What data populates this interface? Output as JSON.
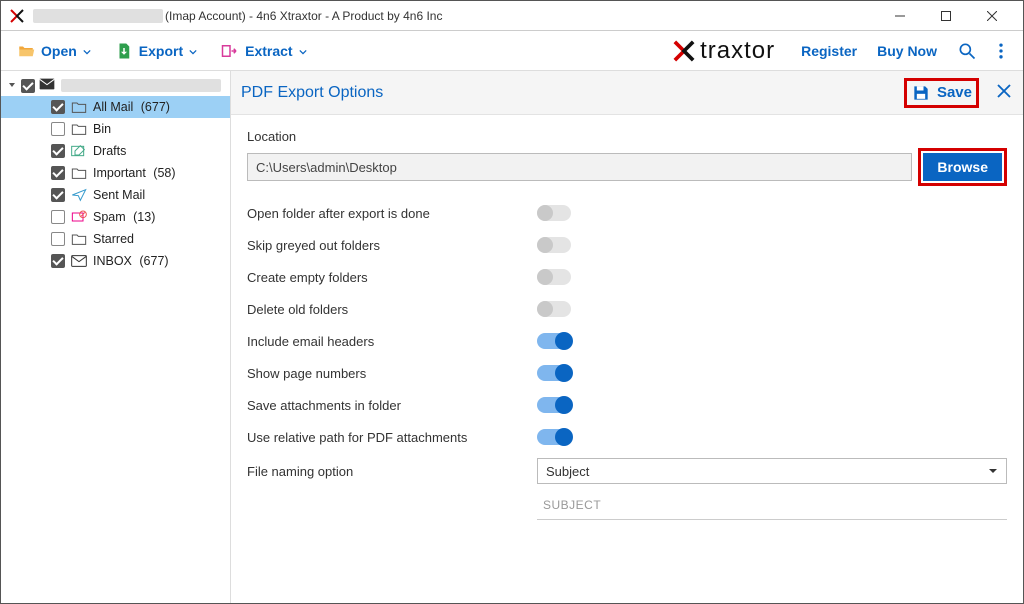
{
  "window": {
    "title_suffix": "(Imap Account) - 4n6 Xtraxtor - A Product by 4n6 Inc"
  },
  "toolbar": {
    "open_label": "Open",
    "export_label": "Export",
    "extract_label": "Extract",
    "register_label": "Register",
    "buynow_label": "Buy Now",
    "brand_text": "traxtor"
  },
  "sidebar": {
    "folders": [
      {
        "label": "All Mail",
        "count": "(677)",
        "checked": true,
        "selected": true,
        "icon": "folder"
      },
      {
        "label": "Bin",
        "count": "",
        "checked": false,
        "selected": false,
        "icon": "folder"
      },
      {
        "label": "Drafts",
        "count": "",
        "checked": true,
        "selected": false,
        "icon": "draft"
      },
      {
        "label": "Important",
        "count": "(58)",
        "checked": true,
        "selected": false,
        "icon": "folder"
      },
      {
        "label": "Sent Mail",
        "count": "",
        "checked": true,
        "selected": false,
        "icon": "sent"
      },
      {
        "label": "Spam",
        "count": "(13)",
        "checked": false,
        "selected": false,
        "icon": "spam"
      },
      {
        "label": "Starred",
        "count": "",
        "checked": false,
        "selected": false,
        "icon": "folder"
      },
      {
        "label": "INBOX",
        "count": "(677)",
        "checked": true,
        "selected": false,
        "icon": "inbox"
      }
    ]
  },
  "panel": {
    "title": "PDF Export Options",
    "save_label": "Save",
    "location_label": "Location",
    "location_value": "C:\\Users\\admin\\Desktop",
    "browse_label": "Browse",
    "options": [
      {
        "label": "Open folder after export is done",
        "on": false
      },
      {
        "label": "Skip greyed out folders",
        "on": false
      },
      {
        "label": "Create empty folders",
        "on": false
      },
      {
        "label": "Delete old folders",
        "on": false
      },
      {
        "label": "Include email headers",
        "on": true
      },
      {
        "label": "Show page numbers",
        "on": true
      },
      {
        "label": "Save attachments in folder",
        "on": true
      },
      {
        "label": "Use relative path for PDF attachments",
        "on": true
      }
    ],
    "file_naming_label": "File naming option",
    "file_naming_value": "Subject",
    "readonly_value": "SUBJECT"
  }
}
